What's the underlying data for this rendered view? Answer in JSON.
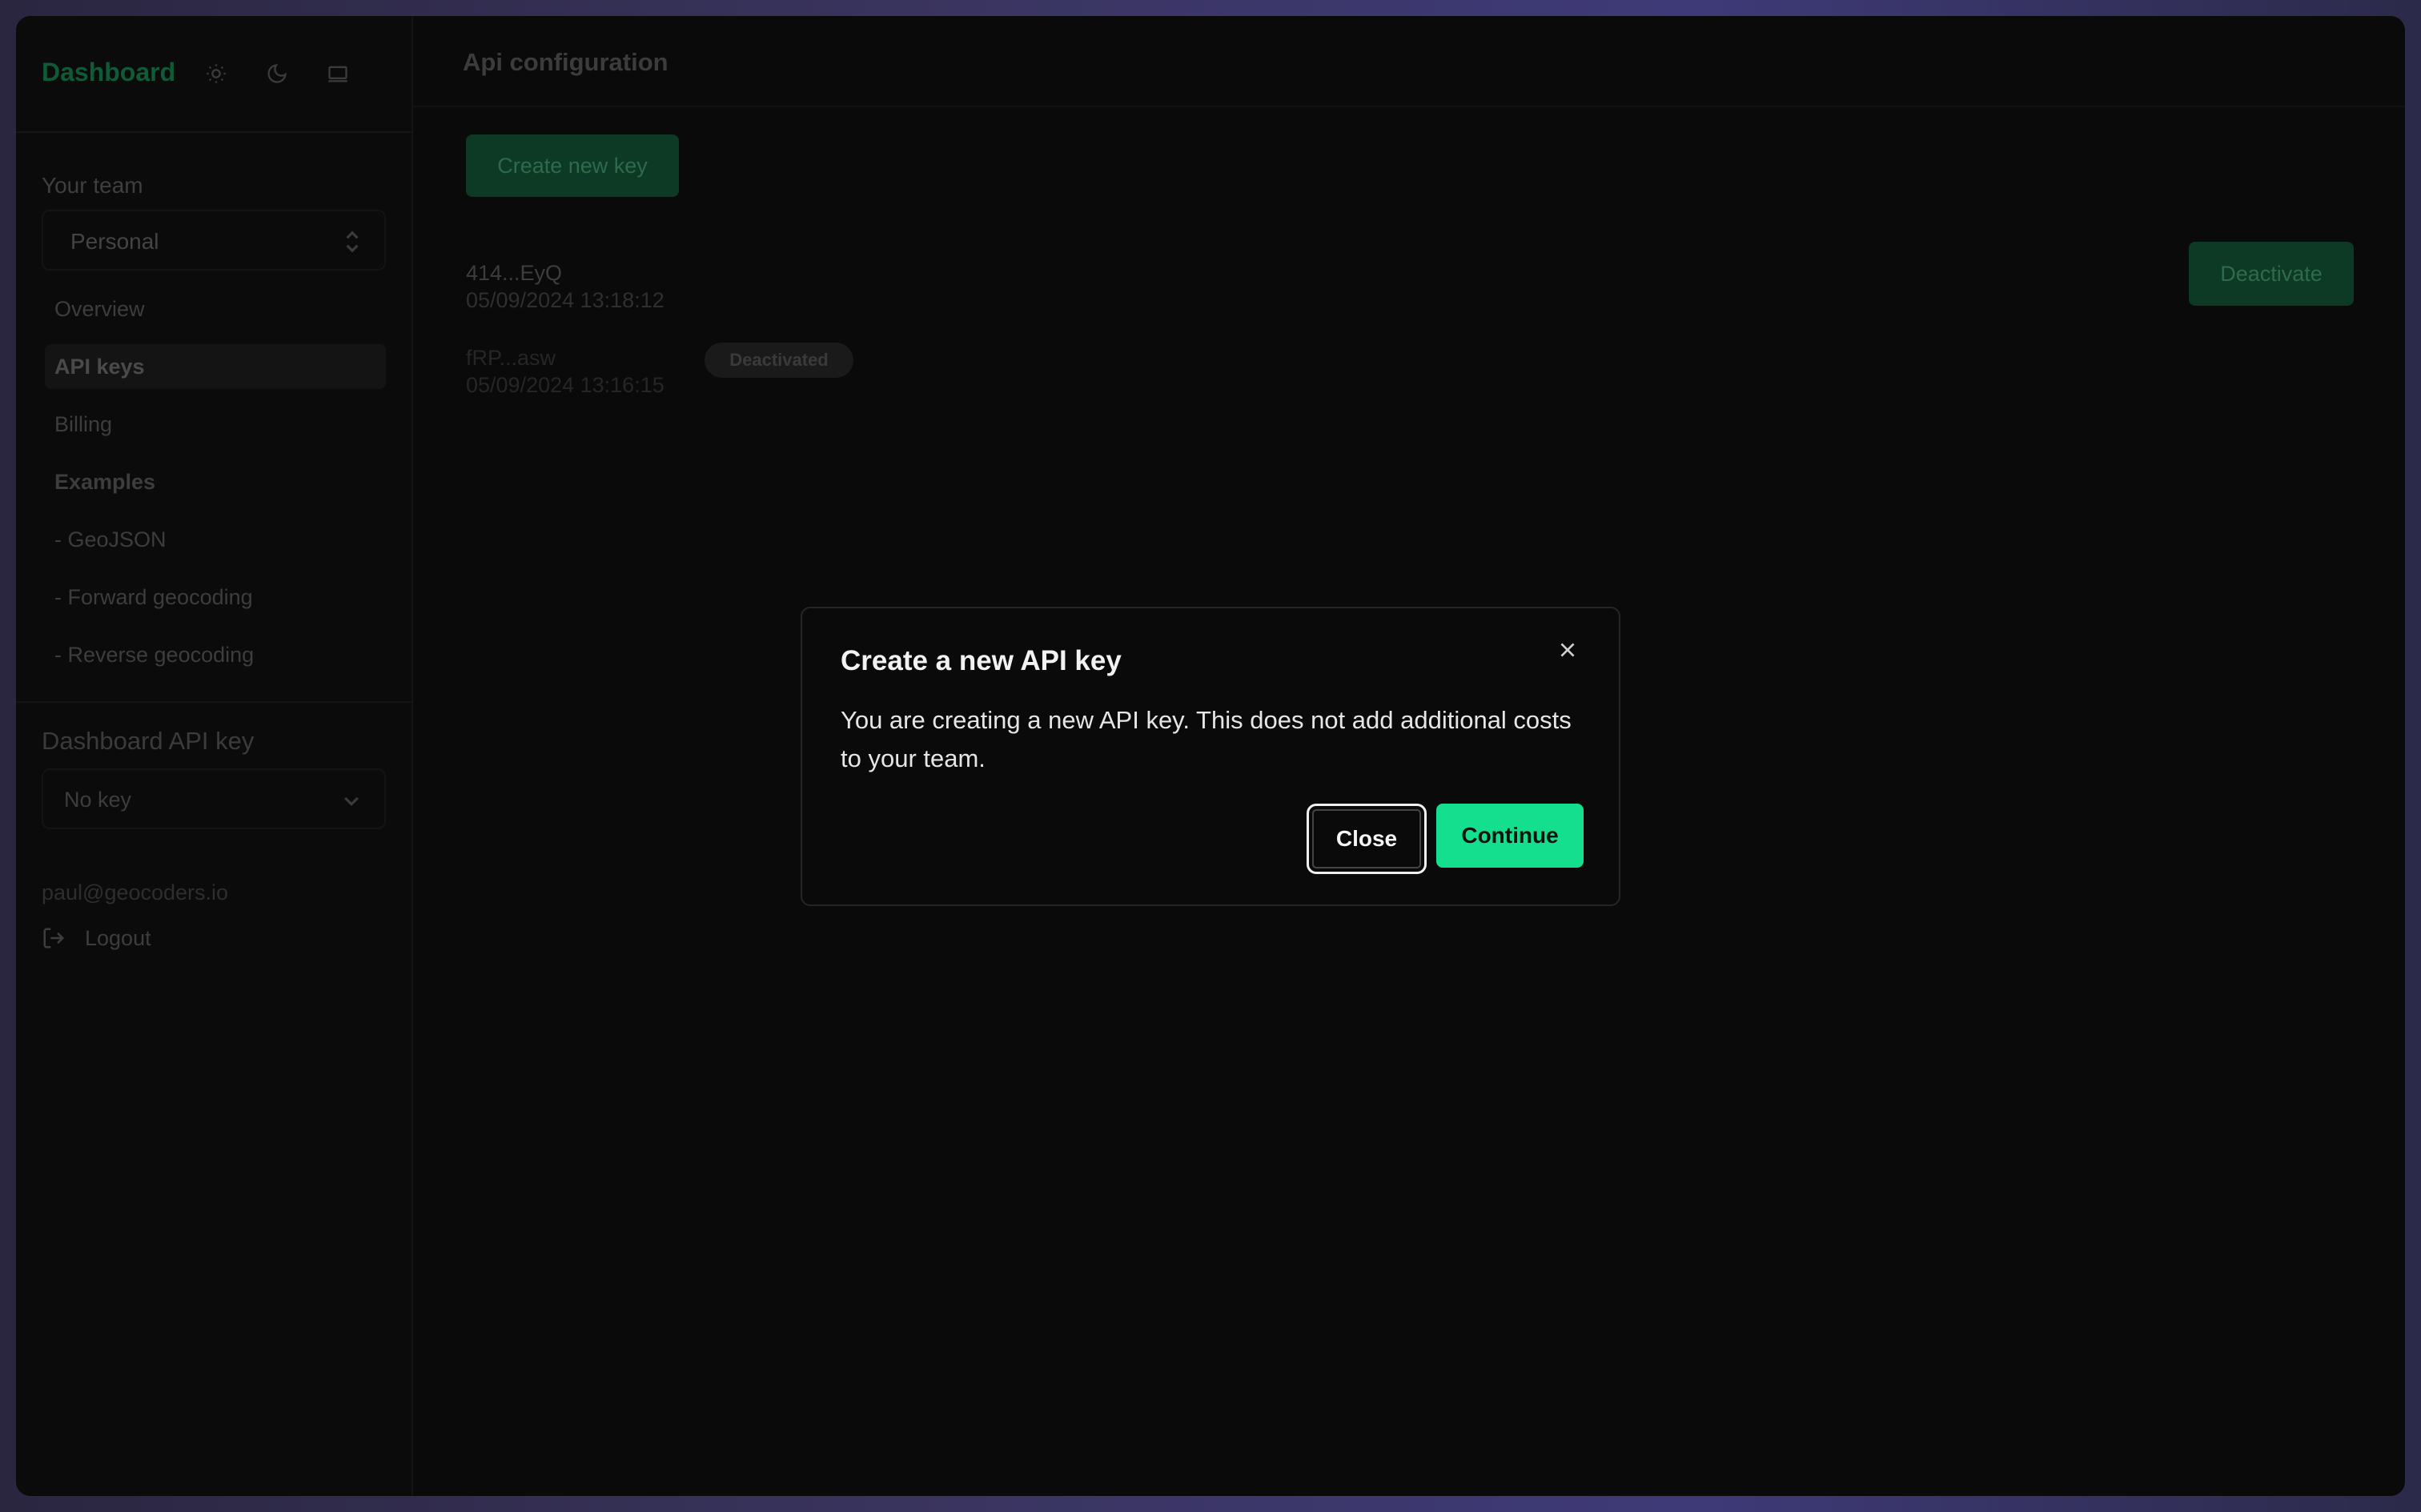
{
  "sidebar": {
    "brand": "Dashboard",
    "theme_icons": [
      "sun-icon",
      "moon-icon",
      "monitor-icon"
    ],
    "team_label": "Your team",
    "team_selected": "Personal",
    "nav": [
      {
        "label": "Overview"
      },
      {
        "label": "API keys",
        "active": true
      },
      {
        "label": "Billing"
      },
      {
        "label": "Examples"
      },
      {
        "label": "- GeoJSON"
      },
      {
        "label": "- Forward geocoding"
      },
      {
        "label": "- Reverse geocoding"
      }
    ],
    "dashboard_api_key_label": "Dashboard API key",
    "dashboard_api_key_value": "No key",
    "user_email": "paul@geocoders.io",
    "logout_label": "Logout"
  },
  "main": {
    "title": "Api configuration",
    "create_button": "Create new key",
    "keys": [
      {
        "name": "414...EyQ",
        "date": "05/09/2024 13:18:12",
        "action": "Deactivate"
      },
      {
        "name": "fRP...asw",
        "date": "05/09/2024 13:16:15",
        "badge": "Deactivated"
      }
    ]
  },
  "modal": {
    "title": "Create a new API key",
    "description": "You are creating a new API key. This does not add additional costs to your team.",
    "close_label": "Close",
    "continue_label": "Continue"
  },
  "colors": {
    "accent": "#14df8e",
    "accent_dimmed": "#0d3a24",
    "background": "#0a0a0a"
  }
}
